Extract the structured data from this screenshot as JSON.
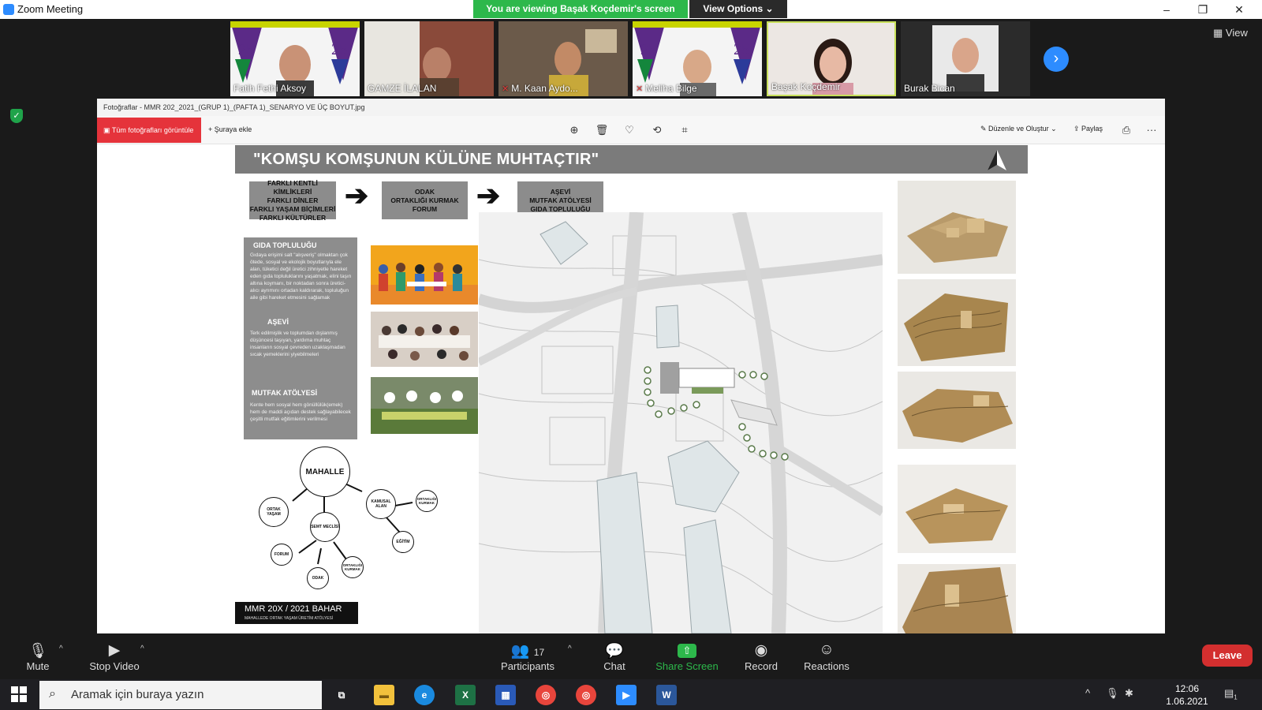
{
  "window": {
    "title": "Zoom Meeting",
    "minimize_icon": "–",
    "restore_icon": "❐",
    "close_icon": "✕"
  },
  "share_banner": {
    "text": "You are viewing Başak Koçdemir's screen",
    "view_options": "View Options"
  },
  "participants": [
    {
      "name": "Fatih Fethi Aksoy",
      "muted": false
    },
    {
      "name": "GAMZE İLALAN",
      "muted": false
    },
    {
      "name": "M. Kaan Aydo...",
      "muted": true
    },
    {
      "name": "Meliha Bilge",
      "muted": true
    },
    {
      "name": "Başak Koçdemir",
      "muted": false
    },
    {
      "name": "Burak Bican",
      "muted": false
    }
  ],
  "gallery_view_label": "View",
  "viewer": {
    "title": "Fotoğraflar - MMR 202_2021_(GRUP 1)_(PAFTA 1)_SENARYO VE ÜÇ BOYUT.jpg",
    "all_photos": "Tüm fotoğrafları görüntüle",
    "add_to": "Şuraya ekle",
    "edit_create": "Düzenle ve Oluştur",
    "share": "Paylaş",
    "more": "···"
  },
  "poster": {
    "title": "\"KOMŞU KOMŞUNUN KÜLÜNE MUHTAÇTIR\"",
    "flow": [
      {
        "lines": [
          "FARKLI KENTLİ KİMLİKLERİ",
          "FARKLI DİNLER",
          "FARKLI YAŞAM BİÇİMLERİ",
          "FARKLI KÜLTÜRLER"
        ]
      },
      {
        "lines": [
          "ODAK",
          "ORTAKLIĞI KURMAK",
          "FORUM"
        ]
      },
      {
        "lines": [
          "AŞEVİ",
          "MUTFAK ATÖLYESİ",
          "GIDA TOPLULUĞU"
        ]
      }
    ],
    "sections": [
      {
        "heading": "GIDA TOPLULUĞU",
        "body": "Gıdaya erişimi salt \"alışveriş\" olmaktan çok ötede, sosyal ve ekolojik boyutlarıyla ele alan, tüketici değil üretici zihniyetle hareket eden gıda topluluklarını yaşatmak, elini taşın altına koymanı, bir noktadan sonra üretici-alıcı ayrımını ortadan kaldırarak, topluluğun aile gibi hareket etmesini sağlamak"
      },
      {
        "heading": "AŞEVİ",
        "body": "Terk edilmişlik ve toplumdan dışlanmış düşüncesi taşıyan, yardıma muhtaç insanların sosyal çevreden uzaklaşmadan sıcak yemeklerini yiyebilmeleri"
      },
      {
        "heading": "MUTFAK ATÖLYESİ",
        "body": "Kente hem sosyal hem gönüllülük(emek) hem de maddi açıdan destek sağlayabilecek çeşitli mutfak eğitimlerini verilmesi"
      }
    ],
    "diagram": {
      "center": "MAHALLE",
      "nodes": [
        "ORTAK YAŞAM",
        "SEMT MECLİSİ",
        "KAMUSAL ALAN",
        "ORTAKLIĞI KURMAK",
        "EĞİTİM",
        "FORUM",
        "ODAK",
        "ORTAKLIĞI KURMAK"
      ]
    },
    "footer": {
      "title": "MMR 20X / 2021 BAHAR",
      "subtitle": "MAHALLEDE ORTAK YAŞAM ÜRETİM ATÖLYESİ"
    }
  },
  "controls": {
    "mute": "Mute",
    "stop_video": "Stop Video",
    "participants": "Participants",
    "participant_count": "17",
    "chat": "Chat",
    "share_screen": "Share Screen",
    "record": "Record",
    "reactions": "Reactions",
    "leave": "Leave"
  },
  "taskbar": {
    "search_placeholder": "Aramak için buraya yazın",
    "time": "12:06",
    "date": "1.06.2021",
    "notification_count": "1"
  },
  "colors": {
    "zoom_blue": "#2d8cff",
    "share_green": "#2db84b",
    "leave_red": "#d32f2f",
    "photos_red": "#e5333b"
  }
}
